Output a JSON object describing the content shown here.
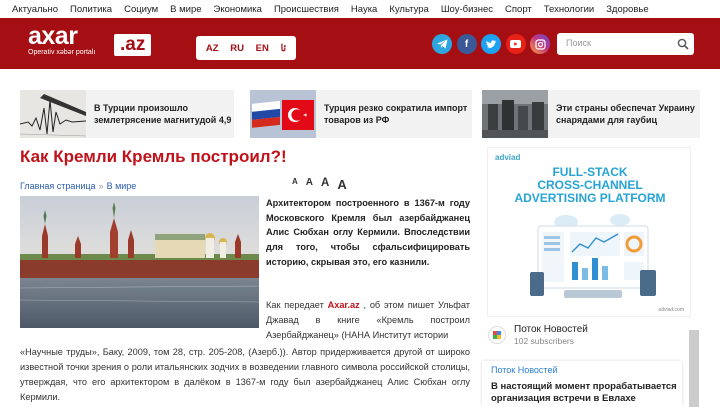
{
  "topnav": [
    "Актуально",
    "Политика",
    "Социум",
    "В мире",
    "Экономика",
    "Происшествия",
    "Наука",
    "Культура",
    "Шоу-бизнес",
    "Спорт",
    "Технологии",
    "Здоровье"
  ],
  "brand": {
    "name": "axar",
    "tld": ".az",
    "tagline": "Operativ xəbər portalı",
    "color": "#a50f13"
  },
  "languages": [
    "AZ",
    "RU",
    "EN",
    "ئا"
  ],
  "socials": [
    {
      "name": "telegram-icon",
      "color": "#2ca5e0",
      "glyph": "➤"
    },
    {
      "name": "facebook-icon",
      "color": "#3b5998",
      "glyph": "f"
    },
    {
      "name": "twitter-icon",
      "color": "#1da1f2",
      "glyph": "t"
    },
    {
      "name": "youtube-icon",
      "color": "#e62117",
      "glyph": "▶"
    },
    {
      "name": "instagram-icon",
      "color": "#c13584",
      "glyph": "◎"
    }
  ],
  "search": {
    "placeholder": "Поиск"
  },
  "teasers": [
    {
      "title": "В Турции произошло землетрясение магнитудой 4,9"
    },
    {
      "title": "Турция резко сократила импорт товаров из РФ"
    },
    {
      "title": "Эти страны обеспечат Украину снарядами для гаубиц"
    }
  ],
  "article": {
    "title": "Как Кремли Кремль построил?!",
    "breadcrumb": [
      "Главная страница",
      "В мире"
    ],
    "font_controls": [
      "A",
      "A",
      "A",
      "A"
    ],
    "lead": "Архитектором построенного в 1367-м году Московского Кремля был азербайджанец Алис Сюбхан оглу Кермили. Впоследствии для того, чтобы сфальсифицировать историю, скрывая это, его казнили.",
    "source_prefix": "Как передает",
    "source_name": "Axar.az",
    "source_suffix": ", об этом пишет Ульфат Джавад в книге «Кремль построил Азербайджанец» (НАНА Институт истории",
    "body": "«Научные труды», Баку, 2009, том 28, стр. 205-208, (Азерб.)). Автор придерживается другой от широко известной точки зрения о роли итальянских зодчих в возведении главного символа российской столицы, утверждая, что его архитектором в далёком в 1367-м году был азербайджанец Алис Сюбхан оглу Кермили."
  },
  "ad": {
    "logo": "adviad",
    "title_lines": [
      "FULL-STACK",
      "CROSS-CHANNEL",
      "ADVERTISING PLATFORM"
    ],
    "footer": "adviad.com"
  },
  "news_feed": {
    "channel": "Поток Новостей",
    "subscribers": "102 subscribers",
    "card_title": "Поток Новостей",
    "card_text": "В настоящий момент прорабатывается организация встречи в Евлахе"
  }
}
